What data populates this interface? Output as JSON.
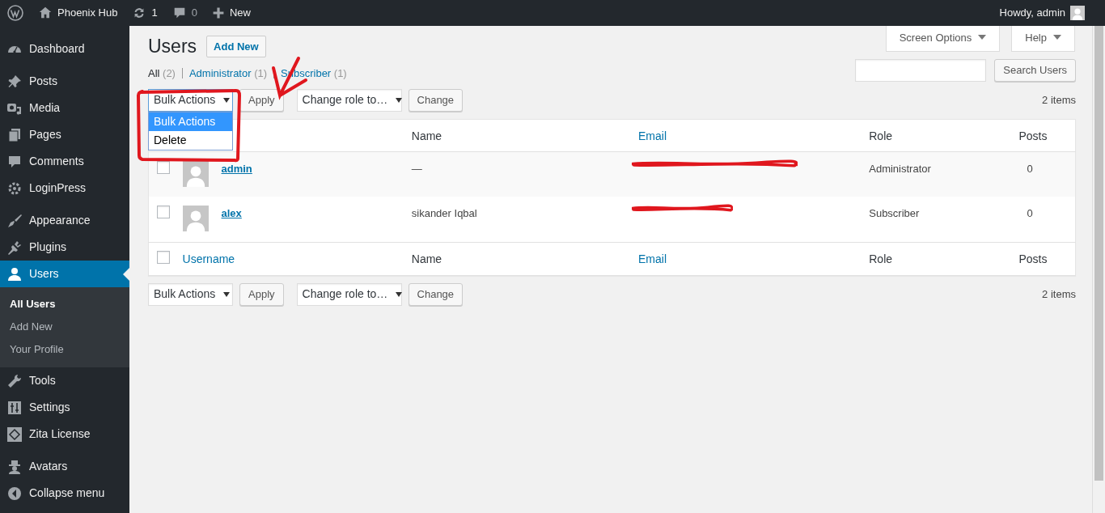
{
  "top_bar": {
    "site": "Phoenix Hub",
    "updates": "1",
    "comments": "0",
    "new": "New",
    "greeting": "Howdy, admin"
  },
  "sidebar": {
    "groups": [
      [
        {
          "label": "Dashboard",
          "selected": false
        }
      ],
      [
        {
          "label": "Posts",
          "selected": false
        },
        {
          "label": "Media",
          "selected": false
        },
        {
          "label": "Pages",
          "selected": false
        },
        {
          "label": "Comments",
          "selected": false
        },
        {
          "label": "LoginPress",
          "selected": false
        }
      ],
      [
        {
          "label": "Appearance",
          "selected": false
        },
        {
          "label": "Plugins",
          "selected": false
        },
        {
          "label": "Users",
          "selected": true,
          "children": [
            {
              "label": "All Users",
              "selected": true
            },
            {
              "label": "Add New",
              "selected": false
            },
            {
              "label": "Your Profile",
              "selected": false
            }
          ]
        },
        {
          "label": "Tools",
          "selected": false
        },
        {
          "label": "Settings",
          "selected": false
        },
        {
          "label": "Zita License",
          "selected": false
        }
      ],
      [
        {
          "label": "Avatars",
          "selected": false
        },
        {
          "label": "Collapse menu",
          "selected": false
        }
      ]
    ]
  },
  "screen_options": "Screen Options",
  "help": "Help",
  "header": {
    "title": "Users",
    "add_new": "Add New"
  },
  "filters": [
    {
      "label": "All",
      "count": "(2)",
      "selected": true
    },
    {
      "label": "Administrator",
      "count": "(1)",
      "selected": false
    },
    {
      "label": "Subscriber",
      "count": "(1)",
      "selected": false
    }
  ],
  "search": {
    "button": "Search Users"
  },
  "top_actions": {
    "bulk": "Bulk Actions",
    "apply": "Apply",
    "role": "Change role to…",
    "change": "Change",
    "count": "2 items",
    "dropdown": [
      {
        "label": "Bulk Actions",
        "selected": true
      },
      {
        "label": "Delete",
        "selected": false
      }
    ]
  },
  "table": {
    "header": [
      "Name",
      "Email",
      "Role",
      "Posts"
    ],
    "select_all_checked": false,
    "rows": [
      {
        "username": "admin",
        "name": "—",
        "email_redacted": true,
        "role": "Administrator",
        "posts": "0",
        "checked": false
      },
      {
        "username": "alex",
        "name": "sikander Iqbal",
        "email_redacted": true,
        "role": "Subscriber",
        "posts": "0",
        "checked": false
      }
    ],
    "footer": [
      "Username",
      "Name",
      "Email",
      "Role",
      "Posts"
    ]
  },
  "bottom_actions": {
    "bulk": "Bulk Actions",
    "apply": "Apply",
    "role": "Change role to…",
    "change": "Change",
    "count": "2 items"
  },
  "annotations": {
    "outline_box": true,
    "check_mark": true
  }
}
